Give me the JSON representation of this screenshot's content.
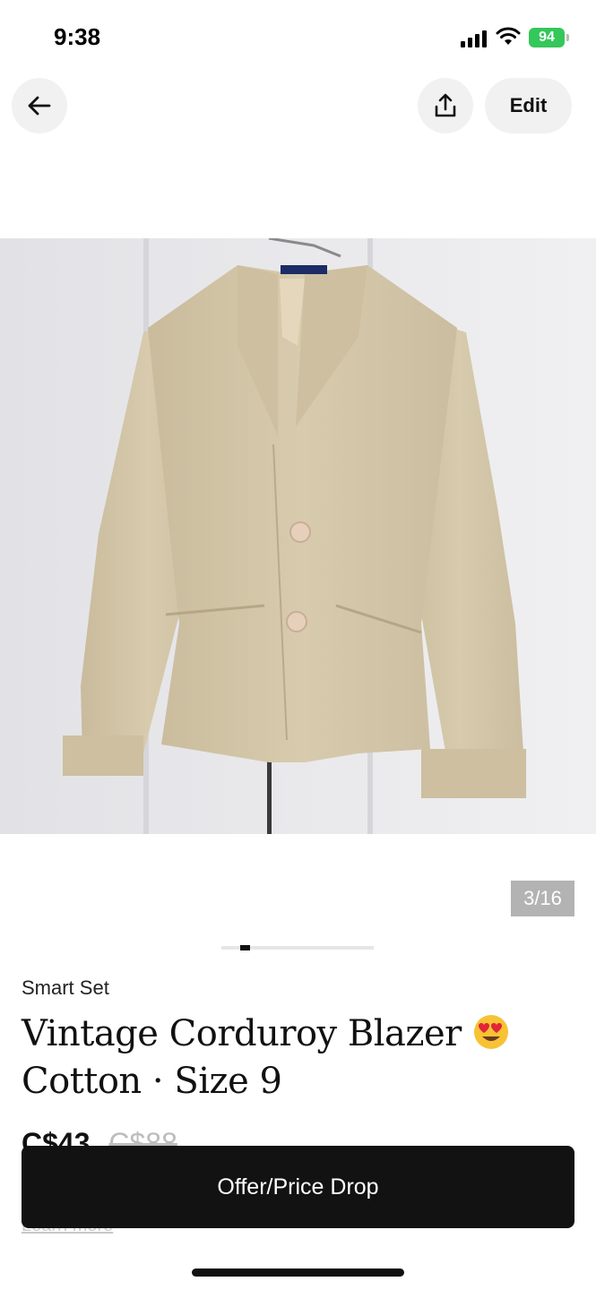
{
  "status_bar": {
    "time": "9:38",
    "battery": "94"
  },
  "nav": {
    "edit_label": "Edit",
    "back_icon": "arrow-left-icon",
    "share_icon": "share-upload-icon"
  },
  "gallery": {
    "counter": "3/16",
    "current": 3,
    "total": 16
  },
  "listing": {
    "brand": "Smart Set",
    "title_line1": "Vintage Corduroy Blazer",
    "title_line2": "Cotton · Size 9",
    "price": "C$43",
    "original_price": "C$88",
    "learn_more": "Learn more"
  },
  "cta": {
    "label": "Offer/Price Drop"
  },
  "colors": {
    "cta_bg": "#121212",
    "battery": "#34c759",
    "jacket": "#d2c4a6"
  }
}
